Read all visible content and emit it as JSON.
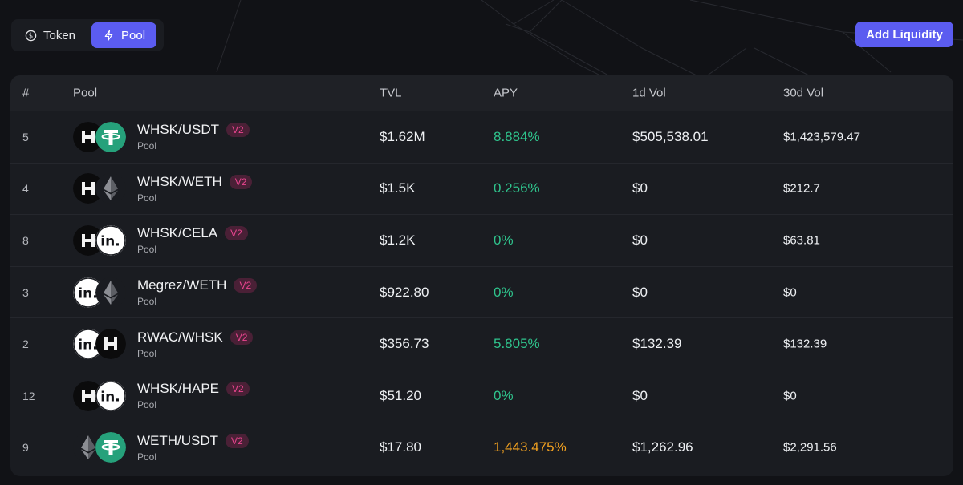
{
  "tabs": [
    {
      "label": "Token",
      "icon": "dollar-circle-icon",
      "active": false
    },
    {
      "label": "Pool",
      "icon": "lightning-icon",
      "active": true
    }
  ],
  "add_liquidity_label": "Add Liquidity",
  "table": {
    "headers": {
      "rank": "#",
      "pool": "Pool",
      "tvl": "TVL",
      "apy": "APY",
      "vol_1d": "1d Vol",
      "vol_30d": "30d Vol"
    },
    "rows": [
      {
        "rank": "5",
        "name": "WHSK/USDT",
        "badge": "V2",
        "sub": "Pool",
        "tvl": "$1.62M",
        "apy": "8.884%",
        "vol_1d": "$505,538.01",
        "vol_30d": "$1,423,579.47",
        "token0": "hsk",
        "token1": "usdt"
      },
      {
        "rank": "4",
        "name": "WHSK/WETH",
        "badge": "V2",
        "sub": "Pool",
        "tvl": "$1.5K",
        "apy": "0.256%",
        "vol_1d": "$0",
        "vol_30d": "$212.7",
        "token0": "hsk",
        "token1": "eth"
      },
      {
        "rank": "8",
        "name": "WHSK/CELA",
        "badge": "V2",
        "sub": "Pool",
        "tvl": "$1.2K",
        "apy": "0%",
        "vol_1d": "$0",
        "vol_30d": "$63.81",
        "token0": "hsk",
        "token1": "in"
      },
      {
        "rank": "3",
        "name": "Megrez/WETH",
        "badge": "V2",
        "sub": "Pool",
        "tvl": "$922.80",
        "apy": "0%",
        "vol_1d": "$0",
        "vol_30d": "$0",
        "token0": "in",
        "token1": "eth"
      },
      {
        "rank": "2",
        "name": "RWAC/WHSK",
        "badge": "V2",
        "sub": "Pool",
        "tvl": "$356.73",
        "apy": "5.805%",
        "vol_1d": "$132.39",
        "vol_30d": "$132.39",
        "token0": "in",
        "token1": "hsk"
      },
      {
        "rank": "12",
        "name": "WHSK/HAPE",
        "badge": "V2",
        "sub": "Pool",
        "tvl": "$51.20",
        "apy": "0%",
        "vol_1d": "$0",
        "vol_30d": "$0",
        "token0": "hsk",
        "token1": "in"
      },
      {
        "rank": "9",
        "name": "WETH/USDT",
        "badge": "V2",
        "sub": "Pool",
        "tvl": "$17.80",
        "apy": "1,443.475%",
        "vol_1d": "$1,262.96",
        "vol_30d": "$2,291.56",
        "token0": "eth",
        "token1": "usdt"
      }
    ]
  },
  "colors": {
    "accent": "#5b5cf0",
    "apy_green": "#2fc48d",
    "apy_orange": "#f0a020",
    "badge_pink": "#e9458f"
  }
}
